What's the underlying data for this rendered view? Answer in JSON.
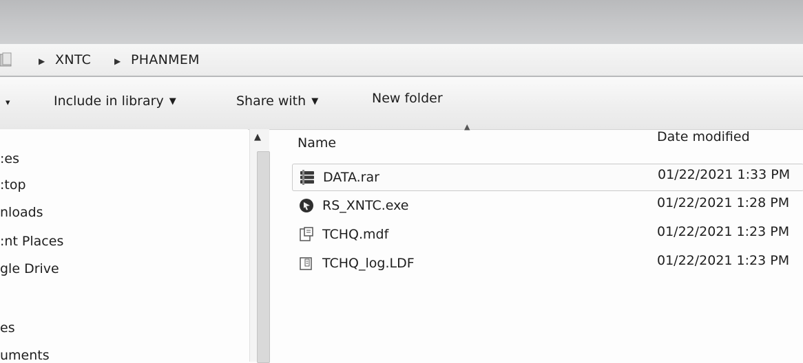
{
  "breadcrumb": [
    "XNTC",
    "PHANMEM"
  ],
  "toolbar": {
    "left_caret": "▾",
    "include_label": "Include in library",
    "share_label": "Share with",
    "new_folder_label": "New folder",
    "dropdown_caret": "▼"
  },
  "nav": {
    "items": [
      ":es",
      ":top",
      "nloads",
      ":nt Places",
      "gle Drive",
      "es",
      "uments"
    ]
  },
  "columns": {
    "name": "Name",
    "date": "Date modified"
  },
  "files": [
    {
      "name": "DATA.rar",
      "date": "01/22/2021 1:33 PM",
      "icon": "archive-icon",
      "selected": true
    },
    {
      "name": "RS_XNTC.exe",
      "date": "01/22/2021 1:28 PM",
      "icon": "app-icon",
      "selected": false
    },
    {
      "name": "TCHQ.mdf",
      "date": "01/22/2021 1:23 PM",
      "icon": "document-icon",
      "selected": false
    },
    {
      "name": "TCHQ_log.LDF",
      "date": "01/22/2021 1:23 PM",
      "icon": "log-file-icon",
      "selected": false
    }
  ],
  "colors": {
    "titlebar": "#c4c5c7",
    "selection_border": "#c9c9c9"
  }
}
